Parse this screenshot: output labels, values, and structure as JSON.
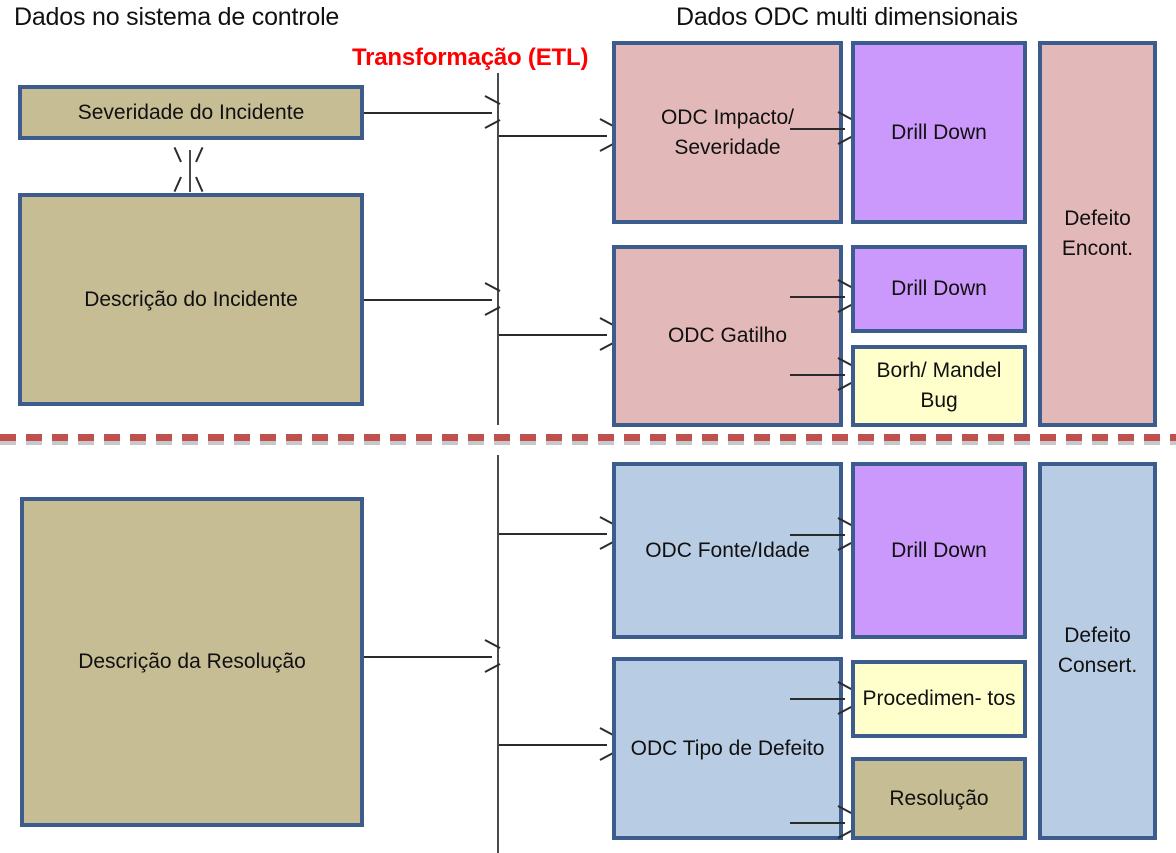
{
  "headings": {
    "left": "Dados no sistema de controle",
    "right": "Dados ODC multi dimensionais",
    "etl": "Transformação (ETL)"
  },
  "colors": {
    "source_box": "#c6bd94",
    "odc_incident": "#e3b8b8",
    "odc_resolution": "#b8cce4",
    "drill_down": "#cb98fb",
    "note": "#ffffcc",
    "border": "#3b5c8c",
    "divider": "#c0504d",
    "etl_label": "#ff0000"
  },
  "top_section": {
    "sources": [
      {
        "label": "Severidade do Incidente"
      },
      {
        "label": "Descrição do Incidente"
      }
    ],
    "odc_dimensions": [
      {
        "label": "ODC Impacto/ Severidade"
      },
      {
        "label": "ODC Gatilho"
      }
    ],
    "analyses": [
      {
        "label": "Drill Down"
      },
      {
        "label": "Drill Down"
      },
      {
        "label": "Borh/ Mandel Bug"
      }
    ],
    "outcome": {
      "label": "Defeito Encont."
    }
  },
  "bottom_section": {
    "sources": [
      {
        "label": "Descrição da Resolução"
      }
    ],
    "odc_dimensions": [
      {
        "label": "ODC Fonte/Idade"
      },
      {
        "label": "ODC Tipo de Defeito"
      }
    ],
    "analyses": [
      {
        "label": "Drill Down"
      },
      {
        "label": "Procedimen- tos"
      },
      {
        "label": "Resolução"
      }
    ],
    "outcome": {
      "label": "Defeito Consert."
    }
  }
}
